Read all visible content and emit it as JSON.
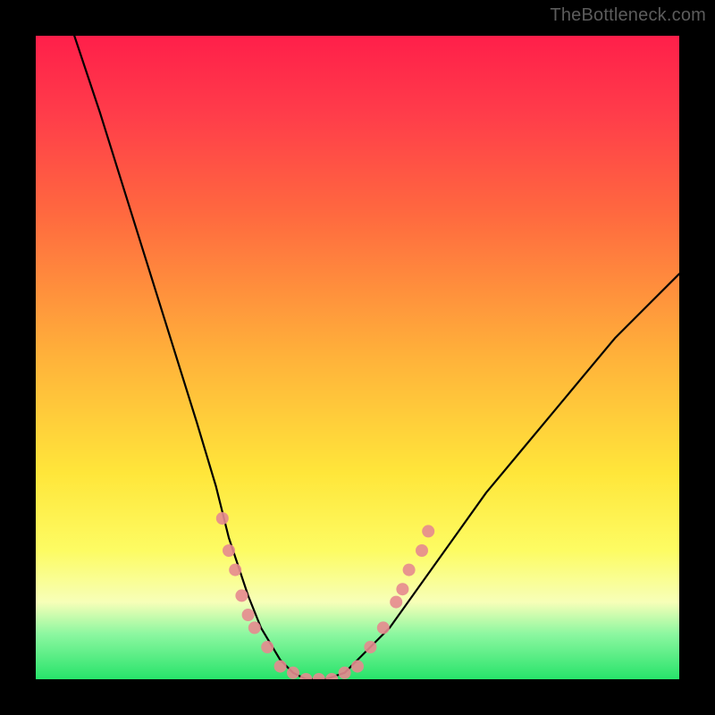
{
  "watermark": "TheBottleneck.com",
  "chart_data": {
    "type": "line",
    "title": "",
    "xlabel": "",
    "ylabel": "",
    "xlim": [
      0,
      100
    ],
    "ylim": [
      0,
      100
    ],
    "series": [
      {
        "name": "bottleneck-curve",
        "x": [
          6,
          10,
          15,
          20,
          25,
          28,
          30,
          33,
          35,
          38,
          40,
          42,
          45,
          48,
          50,
          55,
          60,
          65,
          70,
          75,
          80,
          85,
          90,
          95,
          100
        ],
        "y": [
          100,
          88,
          72,
          56,
          40,
          30,
          22,
          13,
          8,
          3,
          1,
          0,
          0,
          1,
          3,
          8,
          15,
          22,
          29,
          35,
          41,
          47,
          53,
          58,
          63
        ]
      }
    ],
    "markers": {
      "name": "measured-points",
      "color": "#e58a8f",
      "radius": 7,
      "points": [
        {
          "x": 29,
          "y": 25
        },
        {
          "x": 30,
          "y": 20
        },
        {
          "x": 31,
          "y": 17
        },
        {
          "x": 32,
          "y": 13
        },
        {
          "x": 33,
          "y": 10
        },
        {
          "x": 34,
          "y": 8
        },
        {
          "x": 36,
          "y": 5
        },
        {
          "x": 38,
          "y": 2
        },
        {
          "x": 40,
          "y": 1
        },
        {
          "x": 42,
          "y": 0
        },
        {
          "x": 44,
          "y": 0
        },
        {
          "x": 46,
          "y": 0
        },
        {
          "x": 48,
          "y": 1
        },
        {
          "x": 50,
          "y": 2
        },
        {
          "x": 52,
          "y": 5
        },
        {
          "x": 54,
          "y": 8
        },
        {
          "x": 56,
          "y": 12
        },
        {
          "x": 57,
          "y": 14
        },
        {
          "x": 58,
          "y": 17
        },
        {
          "x": 60,
          "y": 20
        },
        {
          "x": 61,
          "y": 23
        }
      ]
    }
  }
}
